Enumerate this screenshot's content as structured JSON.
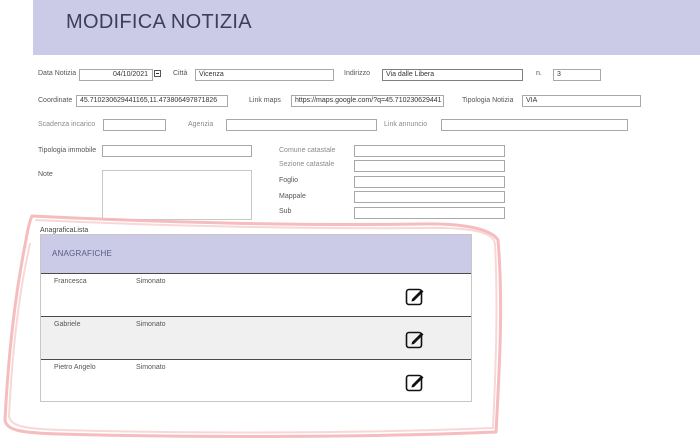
{
  "header": {
    "title": "MODIFICA NOTIZIA"
  },
  "form": {
    "data_notizia": {
      "label": "Data Notizia",
      "value": "04/10/2021"
    },
    "citta": {
      "label": "Città",
      "value": "Vicenza"
    },
    "indirizzo": {
      "label": "Indirizzo",
      "value": "Via dalle Libera"
    },
    "numero": {
      "label": "n.",
      "value": "3"
    },
    "coordinate": {
      "label": "Coordinate",
      "value": "45.710230629441165,11.473806497871826"
    },
    "link_maps": {
      "label": "Link maps",
      "value": "https://maps.google.com/?q=45.710230629441"
    },
    "tipologia_notizia": {
      "label": "Tipologia Notizia",
      "value": "VIA"
    },
    "scadenza_incarico": {
      "label": "Scadenza incarico",
      "value": ""
    },
    "agenzia": {
      "label": "Agenzia",
      "value": ""
    },
    "link_annuncio": {
      "label": "Link annuncio",
      "value": ""
    },
    "tipologia_immobile": {
      "label": "Tipologia immobile",
      "value": ""
    },
    "note": {
      "label": "Note",
      "value": ""
    },
    "comune_catastale": {
      "label": "Comune catastale",
      "value": ""
    },
    "sezione_catastale": {
      "label": "Sezione catastale",
      "value": ""
    },
    "foglio": {
      "label": "Foglio",
      "value": ""
    },
    "mappale": {
      "label": "Mappale",
      "value": ""
    },
    "sub": {
      "label": "Sub",
      "value": ""
    }
  },
  "anagrafiche": {
    "control_label": "AnagraficaLista",
    "header": "ANAGRAFICHE",
    "rows": [
      {
        "first_name": "Francesca",
        "last_name": "Simonato"
      },
      {
        "first_name": "Gabriele",
        "last_name": "Simonato"
      },
      {
        "first_name": "Pietro Angelo",
        "last_name": "Simonato"
      }
    ],
    "edit_icon": "edit-pencil-icon"
  },
  "colors": {
    "header_bg": "#cbcbe8",
    "annotation": "#f4b6b6"
  }
}
